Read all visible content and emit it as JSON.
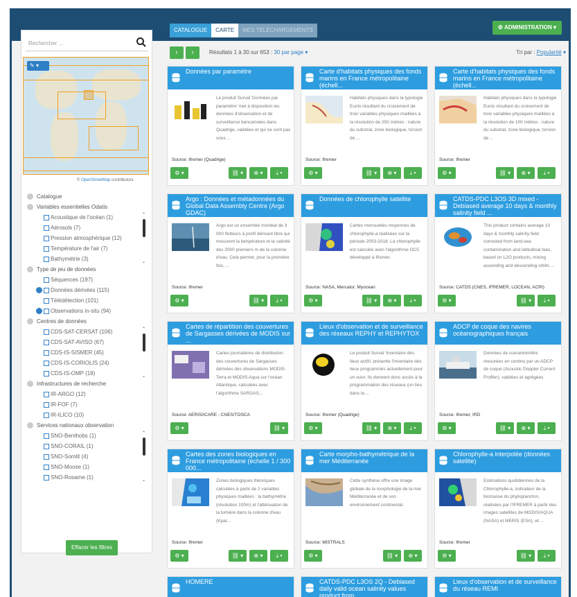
{
  "topbar": {
    "tabs": [
      {
        "label": "CATALOGUE",
        "state": "normal"
      },
      {
        "label": "CARTE",
        "state": "active"
      },
      {
        "label": "MES TÉLÉCHARGEMENTS",
        "state": "disabled"
      }
    ],
    "admin_label": "ADMINISTRATION"
  },
  "sidebar": {
    "search_placeholder": "Rechercher ...",
    "map_attribution_link": "OpenStreetMap",
    "map_attribution_text": " contributors",
    "facets": [
      {
        "title": "Catalogue",
        "items": []
      },
      {
        "title": "Variables essentielles Odatis",
        "items": [
          {
            "label": "Acoustique de l'océan (1)",
            "active": false
          },
          {
            "label": "Aérosols (7)",
            "active": false
          },
          {
            "label": "Pression atmosphérique (12)",
            "active": false
          },
          {
            "label": "Température de l'air (7)",
            "active": false
          },
          {
            "label": "Bathymétrie (3)",
            "active": false
          }
        ]
      },
      {
        "title": "Type de jeu de données",
        "items": [
          {
            "label": "Séquences (197)",
            "active": false
          },
          {
            "label": "Données dérivées (115)",
            "active": true
          },
          {
            "label": "Télédétection (101)",
            "active": false
          },
          {
            "label": "Observations in-situ (94)",
            "active": true
          }
        ]
      },
      {
        "title": "Centres de données",
        "items": [
          {
            "label": "CDS-SAT-CERSAT (106)",
            "active": false
          },
          {
            "label": "CDS-SAT-AVISO (67)",
            "active": false
          },
          {
            "label": "CDS-IS-SISMER (45)",
            "active": false
          },
          {
            "label": "CDS-IS-CORIOLIS (24)",
            "active": false
          },
          {
            "label": "CDS-IS-OMP (18)",
            "active": false
          }
        ]
      },
      {
        "title": "Infrastructures de recherche",
        "items": [
          {
            "label": "IR-ARGO (12)",
            "active": false
          },
          {
            "label": "IR-FOF (7)",
            "active": false
          },
          {
            "label": "IR-ILICO (10)",
            "active": false
          }
        ]
      },
      {
        "title": "Services nationaux observation",
        "items": [
          {
            "label": "SNO-Benthobs (1)",
            "active": false
          },
          {
            "label": "SNO-CORAIL (1)",
            "active": false
          },
          {
            "label": "SNO-Somlit (4)",
            "active": false
          },
          {
            "label": "SNO-Moose (1)",
            "active": false
          },
          {
            "label": "SNO-Rosame (1)",
            "active": false
          }
        ]
      }
    ],
    "clear_filters_label": "Effacer les filtres"
  },
  "toolbar": {
    "prev": "‹",
    "next": "›",
    "results_text": "Résultats 1 à 30 sur 653 : ",
    "per_page": "30 par page",
    "sort_prefix": "Tri par : ",
    "sort_value": "Popularité"
  },
  "cards": [
    {
      "title": "Données par paramètre",
      "desc": "Le produit Surval 'Données par paramètre' met à disposition les données d'observation et de surveillance bancarisées dans Quadrige, validées et qui ne sont pas sous ...",
      "source": "Source: Ifremer (Quadrige)",
      "thumb": "chart",
      "buttons": [
        "gear",
        "link",
        "globe",
        "download"
      ]
    },
    {
      "title": "Carte d'habitats physiques des fonds marins en France métropolitaine (échell...",
      "desc": "Habitats physiques dans la typologie Eunis résultant du croisement de trois variables physiques maillées à la résolution de 250 mètres : nature du substrat, zone biologique, torsion de ...",
      "source": "Source: Ifremer",
      "thumb": "map-coast",
      "buttons": [
        "gear",
        "link",
        "globe",
        "download"
      ]
    },
    {
      "title": "Carte d'habitats physiques des fonds marins en France métropolitaine (échell...",
      "desc": "Habitats physiques dans la typologie Eunis résultant du croisement de trois variables physiques maillées à la résolution de 100 mètres : nature du substrat, zone biologique, torsion de ...",
      "source": "Source: Ifremer",
      "thumb": "map-coast2",
      "buttons": [
        "gear",
        "link",
        "globe",
        "download"
      ]
    },
    {
      "title": "Argo : Données et métadonnées du Global Data Assembly Centre (Argo GDAC)",
      "desc": "Argo est un ensemble mondial de 3 000 flotteurs à profil dérivant libre qui mesurent la température et la salinité des 2000 premiers m de la colonne d'eau. Cela permet, pour la première fois, ...",
      "source": "Source: Ifremer",
      "thumb": "ocean",
      "buttons": [
        "gear",
        "link",
        "download"
      ]
    },
    {
      "title": "Données de chlorophylle satellite",
      "desc": "Cartes mensuelles moyennes de chlorophylle-a réalisées sur la période 2003-2018. La chlorophylle est calculée avec l'algorithme OC5 développé à Ifremer.",
      "source": "Source: NASA, Mercator, Myocean",
      "thumb": "chloro",
      "buttons": [
        "gear",
        "link",
        "globe",
        "download"
      ]
    },
    {
      "title": "CATDS-PDC L3OS 3D mixed - Debiased average 10 days & monthly salinity field ...",
      "desc": "This product contains average 10 days & monthly salinity field corrected from land-sea contamination and latitudinal bias, based on L2O products, mixing ascending and descending orbits ...",
      "source": "Source: CATDS (CNES, IFREMER, LOCEAN, ACRI)",
      "thumb": "globe",
      "buttons": [
        "gear",
        "link",
        "download"
      ]
    },
    {
      "title": "Cartes de répartition des couvertures de Sargasses dérivées de MODIS sur ...",
      "desc": "Cartes journalières de distribution des couvertures de Sargasses dérivées des observations MODIS-Terra et MODIS-Aqua sur l'océan Atlantique, calculées avec l'algorithme SARGAS...",
      "source": "Source: AERIS/ICARE - CNES/TOSCA",
      "thumb": "sargasse",
      "buttons": [
        "gear",
        "link"
      ]
    },
    {
      "title": "Lieux d'observation et de surveillance des réseaux REPHY et REPHYTOX",
      "desc": "Le produit Surval 'Inventaire des lieux actifs' présente l'inventaire des lieux programmés actuellement pour un suivi. Ils donnent donc accès à la programmation des réseaux (un lieu dans la ...",
      "source": "Source: Ifremer (Quadrige)",
      "thumb": "phyto",
      "buttons": [
        "gear",
        "link",
        "globe",
        "download"
      ]
    },
    {
      "title": "ADCP de coque des navires océanographiques français",
      "desc": "Données de courantomètre mesurées en continu par un ADCP de coque (Acoustic Doppler Current Profiler), validées et agrégées.",
      "source": "Source: Ifremer, IRD",
      "thumb": "ship",
      "buttons": [
        "gear",
        "link",
        "globe",
        "download"
      ]
    },
    {
      "title": "Cartes des zones biologiques en France métropolitaine (échelle 1 / 300 000...",
      "desc": "Zones biologiques théoriques calculées à partir de 2 variables physiques maillées : la bathymétrie (résolution 100m) et l'atténuation de la lumière dans la colonne d'eau (Kpar...",
      "source": "Source: Ifremer",
      "thumb": "zones",
      "buttons": [
        "gear",
        "link",
        "globe",
        "download"
      ]
    },
    {
      "title": "Carte morpho-bathymétrique de la mer Méditerranée",
      "desc": "Cette synthèse offre une image globale de la morphologie de la mer Méditerranée et de son environnement continental.",
      "source": "Source: MISTRALS",
      "thumb": "bathy",
      "buttons": [
        "gear",
        "link",
        "globe"
      ]
    },
    {
      "title": "Chlorophylle-a interpolée (données satellite)",
      "desc": "Estimations quotidiennes de la Chlorophylle-a, indicateur de la biomasse du phytoplancton, réalisées par l'IFREMER à partir des images satellites de MODIS/AQUA (NASA) et MERIS (ESA), et ...",
      "source": "Source: Ifremer",
      "thumb": "chloro2",
      "buttons": [
        "gear",
        "link",
        "download"
      ]
    },
    {
      "title": "HOMERE",
      "desc": "",
      "source": "",
      "thumb": "",
      "buttons": []
    },
    {
      "title": "CATDS-PDC L3OS 2Q - Debiased daily valid ocean salinity values product from ...",
      "desc": "",
      "source": "",
      "thumb": "",
      "buttons": []
    },
    {
      "title": "Lieux d'observation et de surveillance du réseau REMI",
      "desc": "",
      "source": "",
      "thumb": "",
      "buttons": []
    }
  ],
  "colors": {
    "topbar": "#1e4d74",
    "header": "#2d9de0",
    "button": "#4caf50",
    "link": "#2f7fc6"
  }
}
